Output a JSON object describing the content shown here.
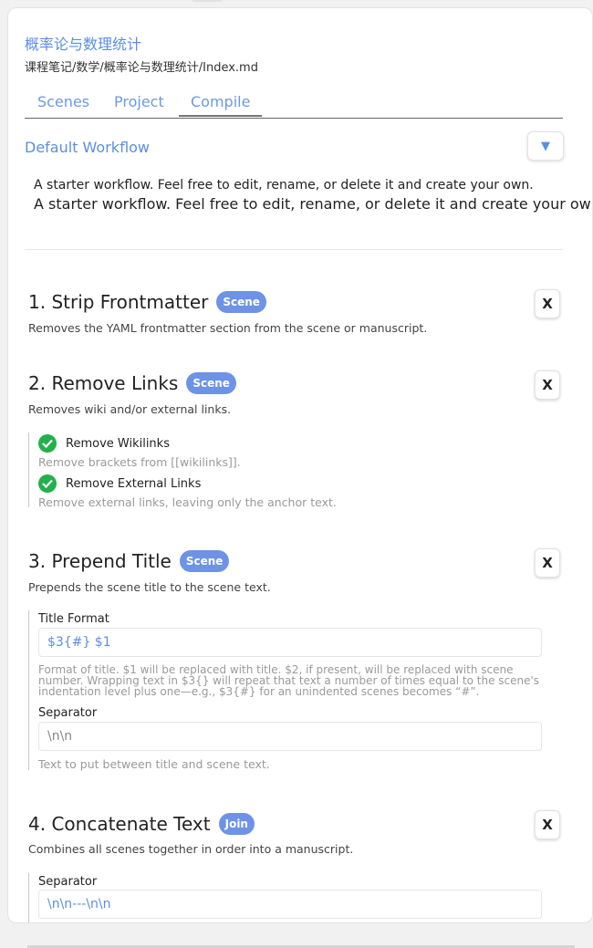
{
  "header": {
    "title": "概率论与数理统计",
    "path": "课程笔记/数学/概率论与数理统计/Index.md"
  },
  "tabs": [
    {
      "label": "Scenes"
    },
    {
      "label": "Project"
    },
    {
      "label": "Compile"
    }
  ],
  "workflow": {
    "name": "Default Workflow",
    "dropdown_icon": "▼",
    "description": "A starter workflow. Feel free to edit, rename, or delete it and create your own.",
    "description_large": "A starter workflow. Feel free to edit, rename, or delete it and create your own."
  },
  "close_label": "X",
  "steps": [
    {
      "title": "1. Strip Frontmatter",
      "badge": "Scene",
      "description": "Removes the YAML frontmatter section from the scene or manuscript."
    },
    {
      "title": "2. Remove Links",
      "badge": "Scene",
      "description": "Removes wiki and/or external links.",
      "options": [
        {
          "label": "Remove Wikilinks",
          "description": "Remove brackets from [[wikilinks]]."
        },
        {
          "label": "Remove External Links",
          "description": "Remove external links, leaving only the anchor text."
        }
      ]
    },
    {
      "title": "3. Prepend Title",
      "badge": "Scene",
      "description": "Prepends the scene title to the scene text.",
      "title_format_label": "Title Format",
      "title_format_value": "$3{#} $1",
      "title_format_help_1": "Format of title. $1 will be replaced with title. $2, if present, will be replaced with scene",
      "title_format_help_2": "number. Wrapping text in $3{} will repeat that text a number of times equal to the scene's",
      "title_format_help_3": "indentation level plus one—e.g., $3{#} for an unindented scenes becomes “#”.",
      "separator_label": "Separator",
      "separator_value": "\\n\\n",
      "separator_help": "Text to put between title and scene text."
    },
    {
      "title": "4. Concatenate Text",
      "badge": "Join",
      "description": "Combines all scenes together in order into a manuscript.",
      "separator_label": "Separator",
      "separator_value": "\\n\\n---\\n\\n"
    }
  ],
  "colors": {
    "accent": "#5b8fe0",
    "badge": "#6e93e6",
    "check": "#22b14c"
  }
}
